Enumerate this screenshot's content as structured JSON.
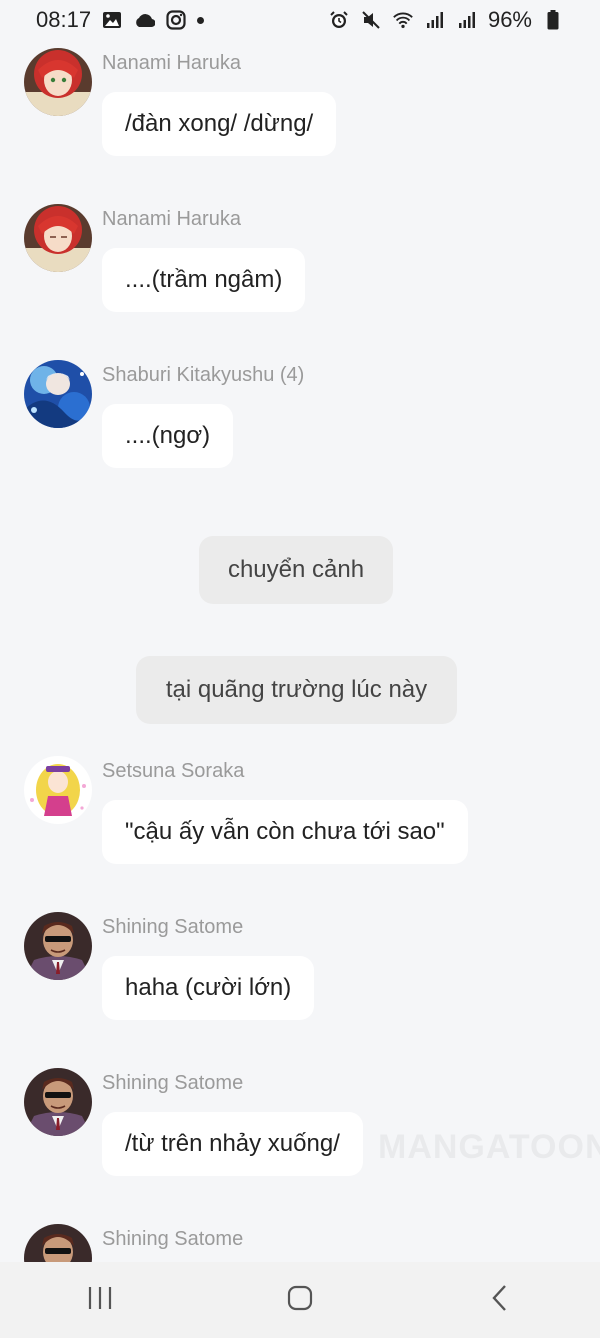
{
  "status_bar": {
    "time": "08:17",
    "battery": "96%",
    "left_icons": [
      "gallery-icon",
      "cloud-icon",
      "instagram-icon",
      "dot-icon"
    ],
    "right_icons": [
      "alarm-icon",
      "mute-icon",
      "wifi-icon",
      "signal-icon",
      "signal-icon",
      "battery-icon"
    ]
  },
  "messages": [
    {
      "sender": "Nanami Haruka",
      "text": "/đàn xong/ /dừng/",
      "avatar": "red-hair-avatar"
    },
    {
      "sender": "Nanami Haruka",
      "text": "....(trầm ngâm)",
      "avatar": "red-hair-avatar"
    },
    {
      "sender": "Shaburi Kitakyushu (4)",
      "text": "....(ngơ)",
      "avatar": "blue-art-avatar"
    }
  ],
  "narrations": [
    {
      "text": "chuyển cảnh"
    },
    {
      "text": "tại quãng trường lúc này"
    }
  ],
  "messages_after": [
    {
      "sender": "Setsuna Soraka",
      "text": "\"cậu ấy vẫn còn chưa tới sao\"",
      "avatar": "blonde-avatar"
    },
    {
      "sender": "Shining Satome",
      "text": "haha (cười lớn)",
      "avatar": "sunglasses-avatar"
    },
    {
      "sender": "Shining Satome",
      "text": "/từ trên nhảy xuống/",
      "avatar": "sunglasses-avatar"
    },
    {
      "sender": "Shining Satome",
      "text": "",
      "avatar": "sunglasses-avatar"
    }
  ],
  "watermark": "MANGATOON",
  "nav": {
    "icons": [
      "recent-apps-icon",
      "home-icon",
      "back-icon"
    ]
  },
  "colors": {
    "background": "#f5f6f8",
    "bubble": "#ffffff",
    "narration": "#ebebeb",
    "sender_text": "#9a9a9a"
  }
}
